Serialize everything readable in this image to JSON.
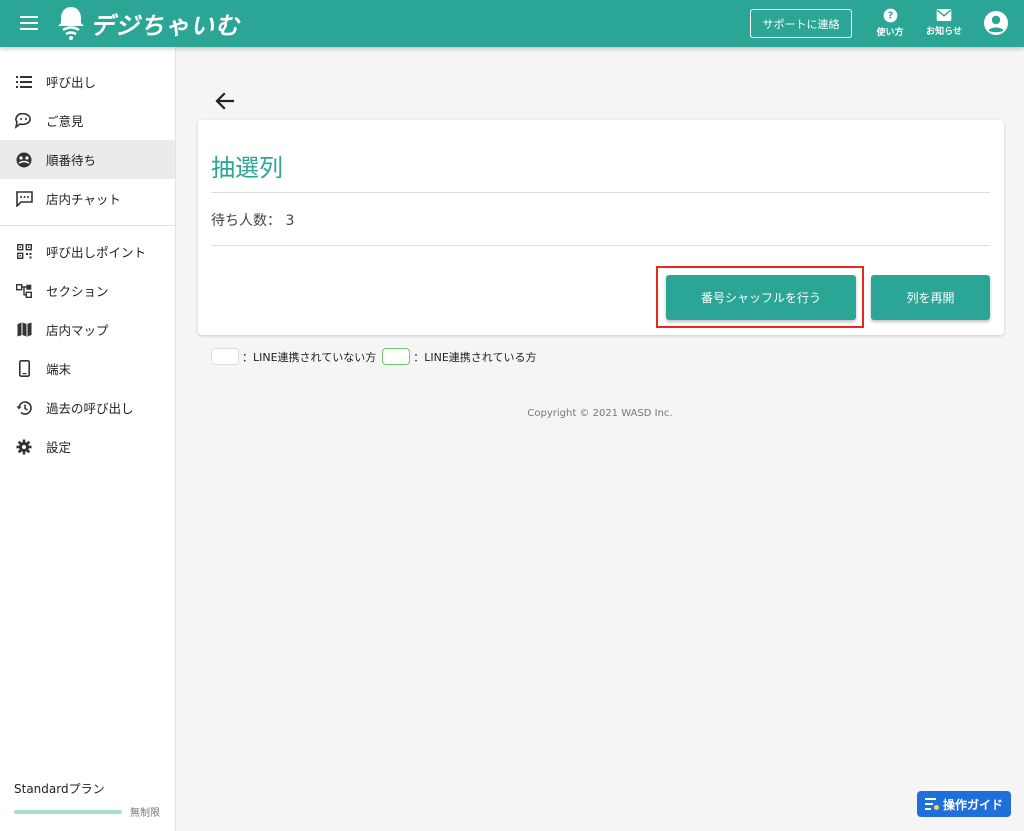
{
  "app": {
    "logo_text": "デジちゃいむ",
    "support_label": "サポートに連絡",
    "help_label": "使い方",
    "notice_label": "お知らせ"
  },
  "sidebar": {
    "items": [
      {
        "label": "呼び出し",
        "icon": "list-icon"
      },
      {
        "label": "ご意見",
        "icon": "feedback-icon"
      },
      {
        "label": "順番待ち",
        "icon": "queue-icon",
        "active": true
      },
      {
        "label": "店内チャット",
        "icon": "chat-icon"
      },
      {
        "label": "呼び出しポイント",
        "icon": "qr-code-icon"
      },
      {
        "label": "セクション",
        "icon": "section-icon"
      },
      {
        "label": "店内マップ",
        "icon": "map-icon"
      },
      {
        "label": "端末",
        "icon": "phone-icon"
      },
      {
        "label": "過去の呼び出し",
        "icon": "history-icon"
      },
      {
        "label": "設定",
        "icon": "gear-icon"
      }
    ],
    "plan_name": "Standardプラン",
    "plan_limit": "無制限"
  },
  "main": {
    "title": "抽選列",
    "waiting_label": "待ち人数：",
    "waiting_count": "3",
    "shuffle_label": "番号シャッフルを行う",
    "reopen_label": "列を再開",
    "legend_unlinked": "：LINE連携されていない方",
    "legend_linked": "：LINE連携されている方"
  },
  "footer": {
    "copyright": "Copyright © 2021 WASD Inc."
  },
  "guide_label": "操作ガイド",
  "colors": {
    "primary": "#2ba596",
    "highlight": "#e8281f",
    "guide": "#1e6fd9"
  }
}
